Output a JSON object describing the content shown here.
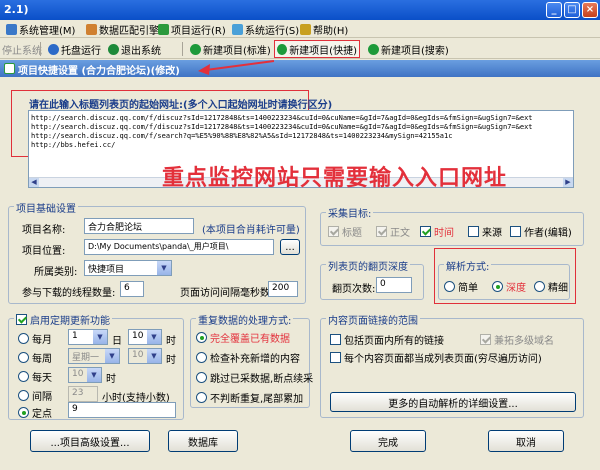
{
  "window": {
    "title": "2.1)",
    "minimize": "_",
    "maximize": "□",
    "close": "×"
  },
  "menu": [
    {
      "label": "系统管理(M)"
    },
    {
      "label": "数据匹配引擎"
    },
    {
      "label": "项目运行(R)"
    },
    {
      "label": "系统运行(S)"
    },
    {
      "label": "帮助(H)"
    }
  ],
  "toolbar": {
    "stop": "停止系统",
    "tray": "托盘运行",
    "exit": "退出系统",
    "new_standard": "新建项目(标准)",
    "new_quick": "新建项目(快捷)",
    "new_search": "新建项目(搜索)"
  },
  "header": {
    "title": "项目快捷设置 (合力合肥论坛)(修改)"
  },
  "url_section": {
    "label": "请在此输入标题列表页的起始网址:(多个入口起始网址时请换行区分)",
    "lines": [
      "http://search.discuz.qq.com/f/discuz?sId=12172848&ts=1400223234&cuId=0&cuName=&gId=7&agId=0&egIds=&fmSign=&ugSign7=&ext",
      "http://search.discuz.qq.com/f/discuz?sId=12172848&ts=1400223234&cuId=0&cuName=&gId=7&agId=0&egIds=&fmSign=&ugSign7=&ext",
      "http://search.discuz.qq.com/f/search?q=%E5%90%88%E8%82%A5&sId=12172848&ts=1400223234&mySign=42155a1c",
      "http://bbs.hefei.cc/"
    ],
    "annotation": "重点监控网站只需要输入入口网址"
  },
  "basic": {
    "legend": "项目基础设置",
    "name_label": "项目名称:",
    "name_value": "合力合肥论坛",
    "note": "(本项目合肖耗许可量)",
    "location_label": "项目位置:",
    "location_value": "D:\\My Documents\\panda\\_用户项目\\",
    "browse": "...",
    "category_label": "所属类别:",
    "category_value": "快捷项目",
    "threads_label": "参与下载的线程数量:",
    "threads_value": "6",
    "interval_label": "页面访问间隔毫秒数:",
    "interval_value": "200"
  },
  "collect": {
    "legend": "采集目标:",
    "items": [
      {
        "label": "标题",
        "checked": true,
        "disabled": true
      },
      {
        "label": "正文",
        "checked": true,
        "disabled": true
      },
      {
        "label": "时间",
        "checked": true,
        "disabled": false
      },
      {
        "label": "来源",
        "checked": false,
        "disabled": false
      },
      {
        "label": "作者(编辑)",
        "checked": false,
        "disabled": false
      }
    ]
  },
  "depth": {
    "legend": "列表页的翻页深度",
    "label": "翻页次数:",
    "value": "0"
  },
  "parse": {
    "legend": "解析方式:",
    "options": [
      {
        "label": "简单",
        "selected": false
      },
      {
        "label": "深度",
        "selected": true
      },
      {
        "label": "精细",
        "selected": false
      }
    ]
  },
  "schedule": {
    "legend": "启用定期更新功能",
    "enabled": true,
    "monthly": {
      "label": "每月",
      "day": "1",
      "day_unit": "日",
      "hour": "10",
      "hour_unit": "时"
    },
    "weekly": {
      "label": "每周",
      "day": "星期一",
      "hour": "10",
      "hour_unit": "时"
    },
    "daily": {
      "label": "每天",
      "hour": "10",
      "hour_unit": "时"
    },
    "interval": {
      "label": "间隔",
      "value": "23",
      "unit": "小时(支持小数)"
    },
    "fixed": {
      "label": "定点",
      "value": "9"
    },
    "selected": "fixed"
  },
  "dup": {
    "legend": "重复数据的处理方式:",
    "options": [
      {
        "label": "完全覆盖已有数据",
        "selected": true
      },
      {
        "label": "检查补充新增的内容",
        "selected": false
      },
      {
        "label": "跳过已采数据,断点续采",
        "selected": false
      },
      {
        "label": "不判断重复,尾部累加",
        "selected": false
      }
    ]
  },
  "links": {
    "legend": "内容页面链接的范围",
    "items": [
      {
        "label": "包括页面内所有的链接",
        "checked": false,
        "disabled": false
      },
      {
        "label": "兼拓多级域名",
        "checked": true,
        "disabled": true
      },
      {
        "label": "每个内容页面都当成列表页面(穷尽遍历访问)",
        "checked": false,
        "disabled": false
      }
    ],
    "more": "更多的自动解析的详细设置..."
  },
  "buttons": {
    "advanced": "...项目高级设置...",
    "database": "数据库",
    "ok": "完成",
    "cancel": "取消"
  }
}
